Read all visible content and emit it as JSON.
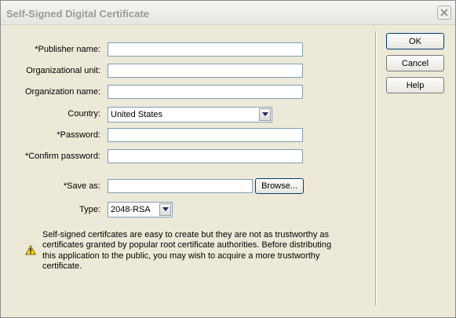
{
  "window": {
    "title": "Self-Signed Digital Certificate"
  },
  "form": {
    "publisher_label": "*Publisher name:",
    "publisher_value": "",
    "org_unit_label": "Organizational unit:",
    "org_unit_value": "",
    "org_name_label": "Organization name:",
    "org_name_value": "",
    "country_label": "Country:",
    "country_value": "United States",
    "password_label": "*Password:",
    "password_value": "",
    "confirm_label": "*Confirm password:",
    "confirm_value": "",
    "save_as_label": "*Save as:",
    "save_as_value": "",
    "browse_label": "Browse...",
    "type_label": "Type:",
    "type_value": "2048-RSA"
  },
  "buttons": {
    "ok_label": "OK",
    "cancel_label": "Cancel",
    "help_label": "Help"
  },
  "warning": {
    "icon": "warning-icon",
    "text": "Self-signed certifcates are easy to create but they are not as trustworthy as certificates granted by popular root certificate authorities. Before distributing this application to the public, you may wish to acquire a more trustworthy certificate."
  }
}
